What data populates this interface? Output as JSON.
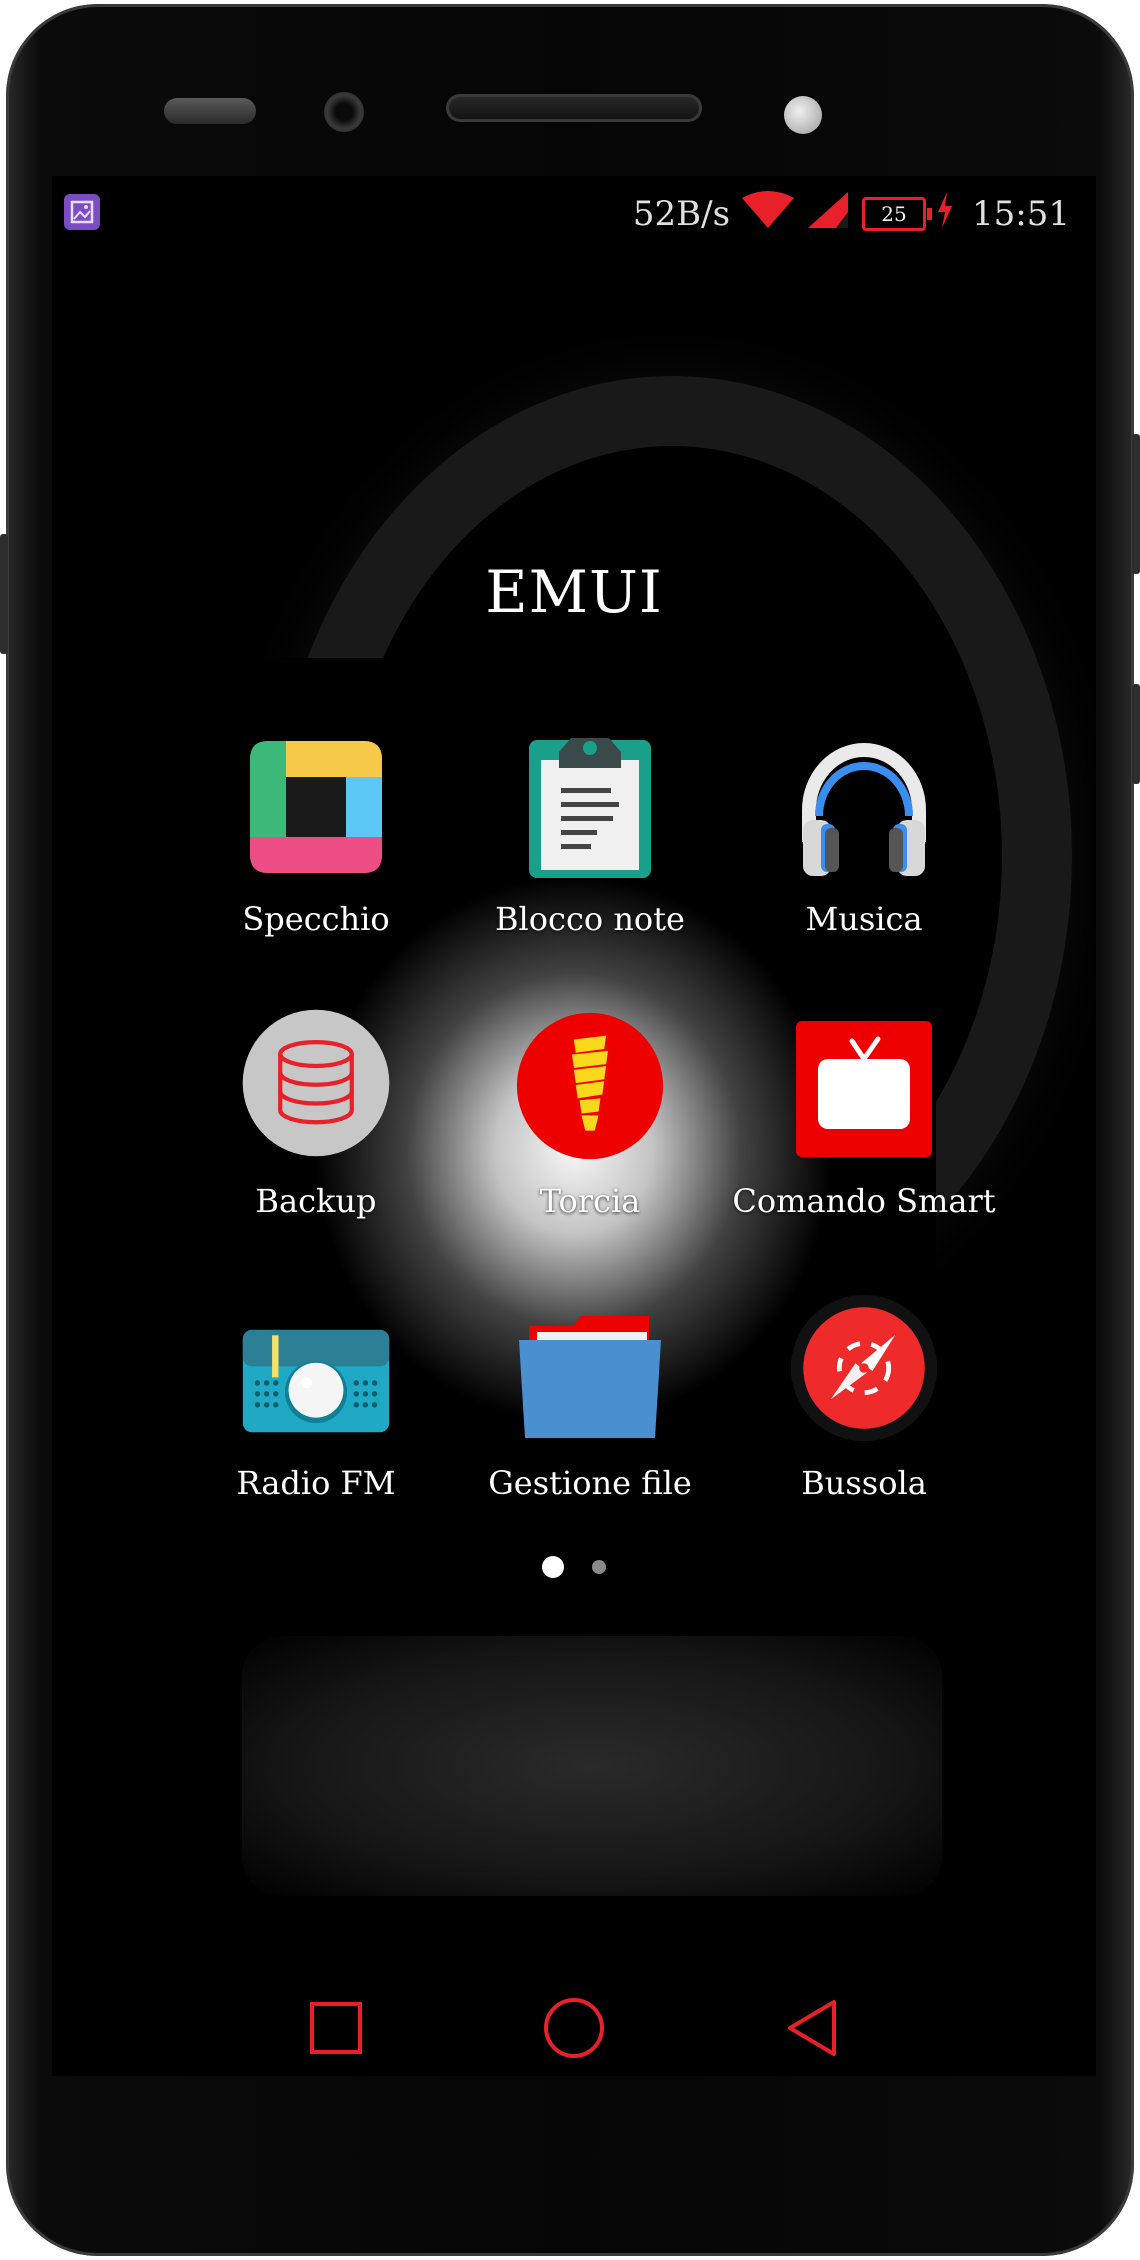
{
  "status_bar": {
    "net_speed": "52B/s",
    "battery_level": "25",
    "time": "15:51",
    "icons": [
      "gallery-notification-icon",
      "wifi-icon",
      "signal-icon",
      "battery-icon",
      "charging-icon"
    ]
  },
  "folder": {
    "title": "EMUI",
    "apps": [
      {
        "label": "Specchio",
        "icon": "mirror-icon"
      },
      {
        "label": "Blocco note",
        "icon": "notepad-icon"
      },
      {
        "label": "Musica",
        "icon": "headphones-icon"
      },
      {
        "label": "Backup",
        "icon": "backup-database-icon"
      },
      {
        "label": "Torcia",
        "icon": "flashlight-bulb-icon"
      },
      {
        "label": "Comando Smart",
        "icon": "tv-remote-icon"
      },
      {
        "label": "Radio FM",
        "icon": "radio-icon"
      },
      {
        "label": "Gestione file",
        "icon": "folder-icon"
      },
      {
        "label": "Bussola",
        "icon": "compass-icon"
      }
    ],
    "page_count": 2,
    "active_page": 1
  },
  "nav_bar": {
    "buttons": [
      "recent-apps-icon",
      "home-icon",
      "back-icon"
    ]
  },
  "colors": {
    "accent_red": "#e8202a",
    "background": "#000000"
  }
}
